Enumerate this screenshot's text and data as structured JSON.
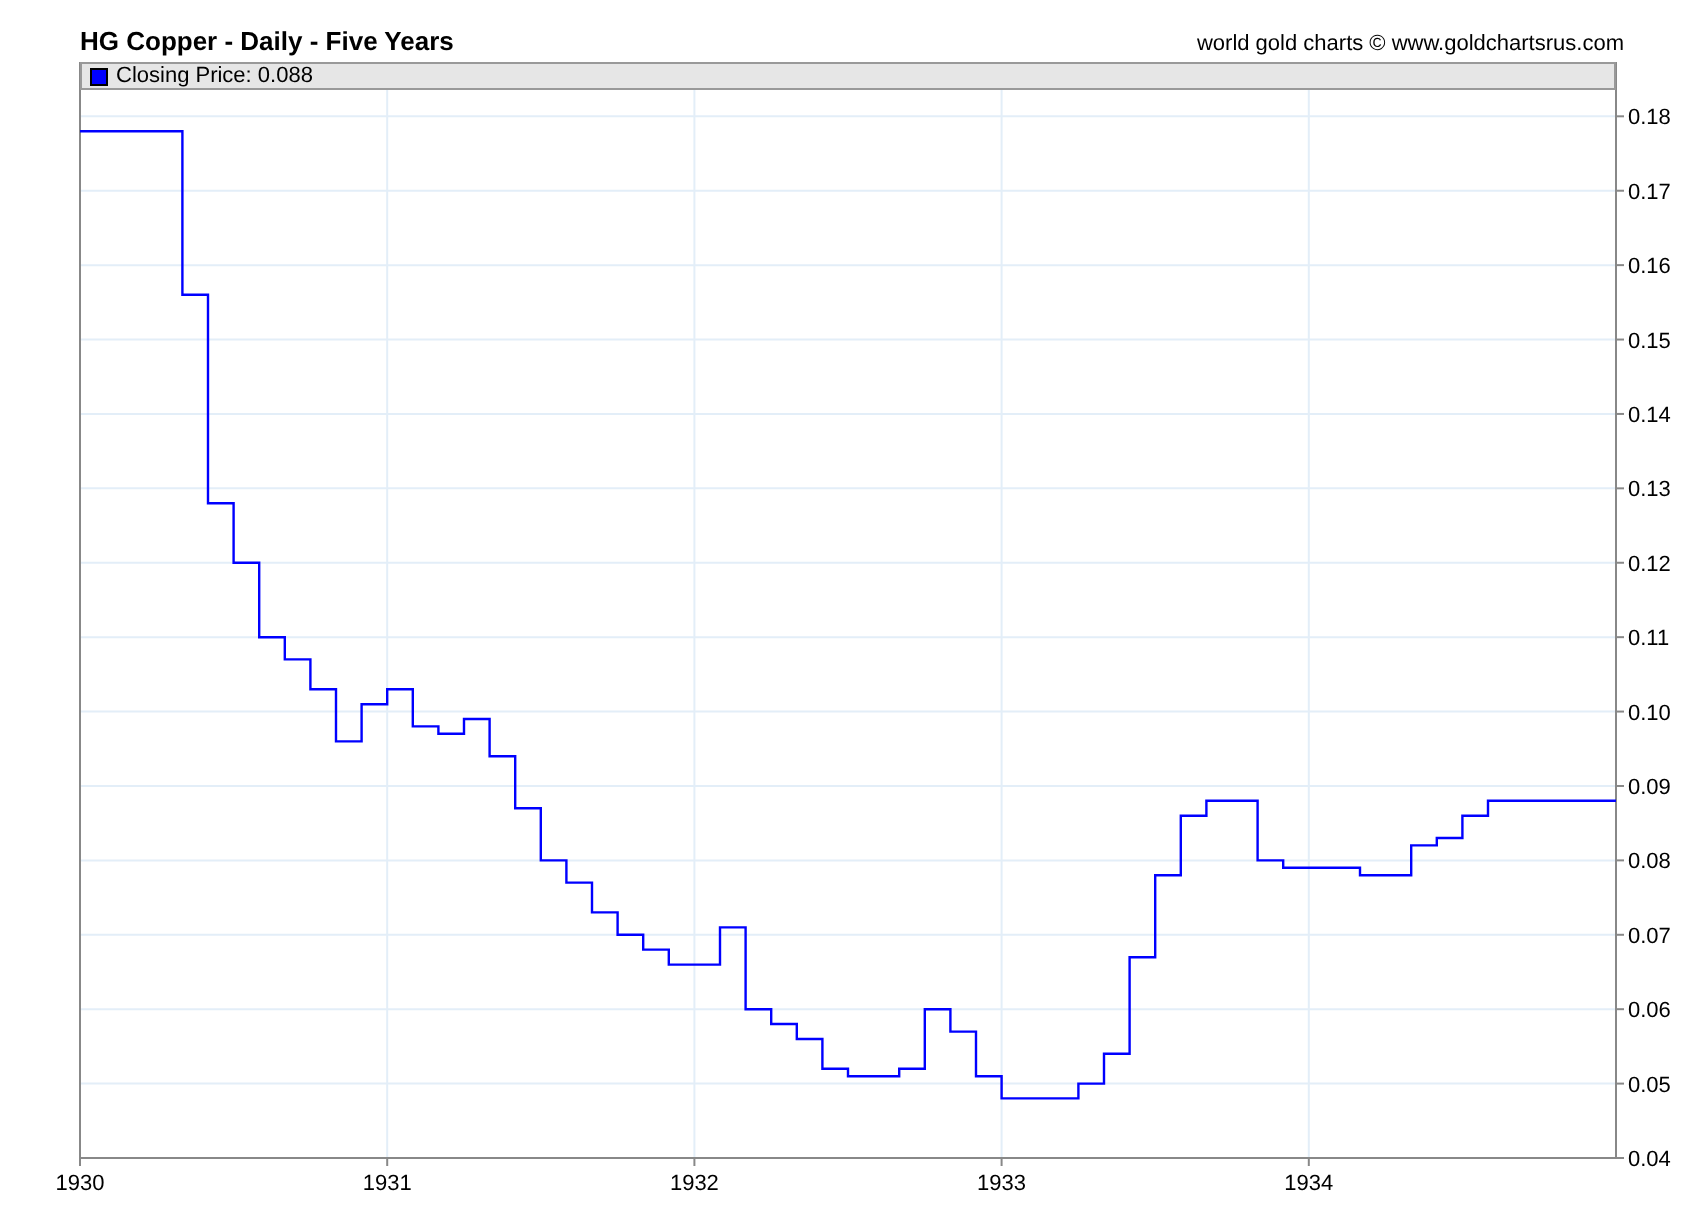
{
  "header": {
    "title": "HG Copper - Daily - Five Years",
    "credit": "world gold charts © www.goldchartsrus.com"
  },
  "chart": {
    "legend": {
      "label": "Closing Price: 0.088"
    },
    "chart_data": {
      "type": "line",
      "grid": true,
      "xlim": [
        1930,
        1935
      ],
      "ylim": [
        0.04,
        0.1873
      ],
      "x": [
        1930,
        1930.3333,
        1930.3333,
        1930.4167,
        1930.4167,
        1930.5,
        1930.5,
        1930.5833,
        1930.5833,
        1930.6667,
        1930.6667,
        1930.75,
        1930.75,
        1930.8333,
        1930.8333,
        1930.9167,
        1930.9167,
        1931,
        1931,
        1931.0833,
        1931.0833,
        1931.1667,
        1931.1667,
        1931.25,
        1931.25,
        1931.3333,
        1931.3333,
        1931.4167,
        1931.4167,
        1931.5,
        1931.5,
        1931.5833,
        1931.5833,
        1931.6667,
        1931.6667,
        1931.75,
        1931.75,
        1931.8333,
        1931.8333,
        1931.9167,
        1931.9167,
        1932.0833,
        1932.0833,
        1932.1667,
        1932.1667,
        1932.25,
        1932.25,
        1932.3333,
        1932.3333,
        1932.4167,
        1932.4167,
        1932.5,
        1932.5,
        1932.6667,
        1932.6667,
        1932.75,
        1932.75,
        1932.8333,
        1932.8333,
        1932.9167,
        1932.9167,
        1933,
        1933,
        1933.25,
        1933.25,
        1933.3333,
        1933.3333,
        1933.4167,
        1933.4167,
        1933.5,
        1933.5,
        1933.5833,
        1933.5833,
        1933.6667,
        1933.6667,
        1933.8333,
        1933.8333,
        1933.9167,
        1933.9167,
        1934.1667,
        1934.1667,
        1934.3333,
        1934.3333,
        1934.4167,
        1934.4167,
        1934.5,
        1934.5,
        1934.5833,
        1934.5833,
        1935
      ],
      "series": [
        {
          "color": "#0000ff",
          "values": [
            0.178,
            0.178,
            0.156,
            0.156,
            0.128,
            0.128,
            0.12,
            0.12,
            0.11,
            0.11,
            0.107,
            0.107,
            0.103,
            0.103,
            0.096,
            0.096,
            0.101,
            0.101,
            0.103,
            0.103,
            0.098,
            0.098,
            0.097,
            0.097,
            0.099,
            0.099,
            0.094,
            0.094,
            0.087,
            0.087,
            0.08,
            0.08,
            0.077,
            0.077,
            0.073,
            0.073,
            0.07,
            0.07,
            0.068,
            0.068,
            0.066,
            0.066,
            0.071,
            0.071,
            0.06,
            0.06,
            0.058,
            0.058,
            0.056,
            0.056,
            0.052,
            0.052,
            0.051,
            0.051,
            0.052,
            0.052,
            0.06,
            0.06,
            0.057,
            0.057,
            0.051,
            0.051,
            0.048,
            0.048,
            0.05,
            0.05,
            0.054,
            0.054,
            0.067,
            0.067,
            0.078,
            0.078,
            0.086,
            0.086,
            0.088,
            0.088,
            0.08,
            0.08,
            0.079,
            0.079,
            0.078,
            0.078,
            0.082,
            0.082,
            0.083,
            0.083,
            0.086,
            0.086,
            0.088,
            0.088
          ]
        }
      ],
      "xticks": [
        {
          "value": 1930,
          "label": "1930"
        },
        {
          "value": 1931,
          "label": "1931"
        },
        {
          "value": 1932,
          "label": "1932"
        },
        {
          "value": 1933,
          "label": "1933"
        },
        {
          "value": 1934,
          "label": "1934"
        }
      ],
      "yticks": [
        {
          "value": 0.04,
          "label": "0.04"
        },
        {
          "value": 0.05,
          "label": "0.05"
        },
        {
          "value": 0.06,
          "label": "0.06"
        },
        {
          "value": 0.07,
          "label": "0.07"
        },
        {
          "value": 0.08,
          "label": "0.08"
        },
        {
          "value": 0.09,
          "label": "0.09"
        },
        {
          "value": 0.1,
          "label": "0.10"
        },
        {
          "value": 0.11,
          "label": "0.11"
        },
        {
          "value": 0.12,
          "label": "0.12"
        },
        {
          "value": 0.13,
          "label": "0.13"
        },
        {
          "value": 0.14,
          "label": "0.14"
        },
        {
          "value": 0.15,
          "label": "0.15"
        },
        {
          "value": 0.16,
          "label": "0.16"
        },
        {
          "value": 0.17,
          "label": "0.17"
        },
        {
          "value": 0.18,
          "label": "0.18"
        }
      ]
    }
  }
}
